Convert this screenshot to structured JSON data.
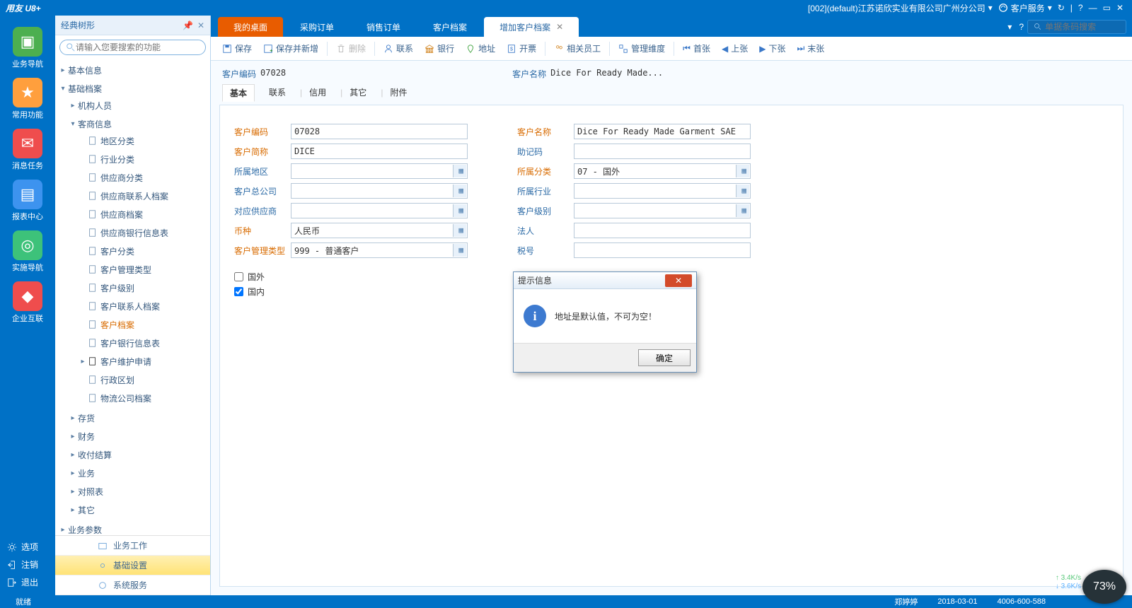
{
  "titlebar": {
    "logo": "用友 U8+",
    "company": "[002](default)江苏诺欣实业有限公司广州分公司",
    "service": "客户服务"
  },
  "sidebar": {
    "items": [
      {
        "label": "业务导航",
        "color": "#4caf50"
      },
      {
        "label": "常用功能",
        "color": "#ff9f3d"
      },
      {
        "label": "消息任务",
        "color": "#ef4d4d"
      },
      {
        "label": "报表中心",
        "color": "#3d93ef"
      },
      {
        "label": "实施导航",
        "color": "#3dc27a"
      },
      {
        "label": "企业互联",
        "color": "#ef4d4d"
      }
    ],
    "options": {
      "opt": "选项",
      "logout": "注销",
      "exit": "退出"
    }
  },
  "tree": {
    "title": "经典树形",
    "search_placeholder": "请输入您要搜索的功能",
    "nodes": {
      "basicinfo": "基本信息",
      "basicfile": "基础档案",
      "org": "机构人员",
      "cust": "客商信息",
      "leaves": [
        "地区分类",
        "行业分类",
        "供应商分类",
        "供应商联系人档案",
        "供应商档案",
        "供应商银行信息表",
        "客户分类",
        "客户管理类型",
        "客户级别",
        "客户联系人档案",
        "客户档案",
        "客户银行信息表",
        "客户维护申请",
        "行政区划",
        "物流公司档案"
      ],
      "inventory": "存货",
      "finance": "财务",
      "receipt": "收付结算",
      "biz": "业务",
      "contrast": "对照表",
      "other": "其它",
      "bizparam": "业务参数"
    },
    "foot": {
      "work": "业务工作",
      "setting": "基础设置",
      "service": "系统服务"
    }
  },
  "tabs": {
    "items": [
      "我的桌面",
      "采购订单",
      "销售订单",
      "客户档案",
      "增加客户档案"
    ],
    "search_placeholder": "单据条码搜索"
  },
  "toolbar": {
    "save": "保存",
    "saveadd": "保存并新增",
    "delete": "删除",
    "contact": "联系",
    "bank": "银行",
    "address": "地址",
    "invoice": "开票",
    "staff": "相关员工",
    "dim": "管理维度",
    "first": "首张",
    "prev": "上张",
    "next": "下张",
    "last": "末张"
  },
  "header": {
    "code_label": "客户编码",
    "code": "07028",
    "name_label": "客户名称",
    "name": "Dice For Ready Made..."
  },
  "ctabs": [
    "基本",
    "联系",
    "信用",
    "其它",
    "附件"
  ],
  "form": {
    "labels": {
      "code": "客户编码",
      "name": "客户名称",
      "short": "客户简称",
      "mnemonic": "助记码",
      "area": "所属地区",
      "cat": "所属分类",
      "hq": "客户总公司",
      "industry": "所属行业",
      "supplier": "对应供应商",
      "level": "客户级别",
      "currency": "币种",
      "legal": "法人",
      "mtype": "客户管理类型",
      "tax": "税号"
    },
    "values": {
      "code": "07028",
      "name": "Dice For Ready Made Garment SAE",
      "short": "DICE",
      "cat": "07 - 国外",
      "currency": "人民币",
      "mtype": "999 - 普通客户"
    },
    "chk": {
      "foreign": "国外",
      "domestic": "国内"
    }
  },
  "dialog": {
    "title": "提示信息",
    "msg": "地址是默认值，不可为空！",
    "ok": "确定"
  },
  "status": {
    "ready": "就绪",
    "user": "郑婷婷",
    "date": "2018-03-01",
    "tel": "4006-600-588"
  },
  "net": {
    "up": "3.4K/s",
    "down": "3.6K/s",
    "pct": "73%"
  }
}
